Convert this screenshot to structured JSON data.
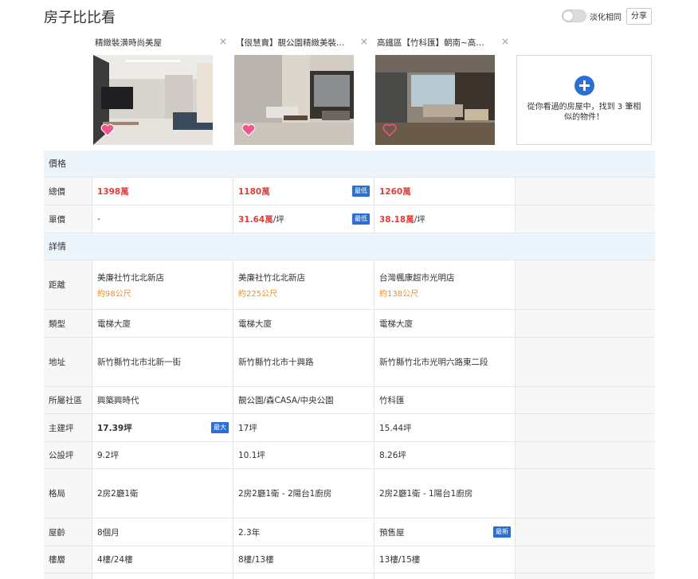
{
  "header": {
    "title": "房子比比看",
    "toggle_label": "淡化相同",
    "share_label": "分享"
  },
  "colors": {
    "accent": "#2c6fd4",
    "price": "#e03c3c",
    "distance": "#f08c1f",
    "section_bg": "#edf5fc",
    "heart": "#f0568c"
  },
  "cards": [
    {
      "title": "精緻裝潢時尚美屋",
      "close": "×",
      "heart": "filled"
    },
    {
      "title": "【很慧賣】靚公園精緻美裝…",
      "close": "×",
      "heart": "filled"
    },
    {
      "title": "高鐵區【竹科匯】朝南~高…",
      "close": "×",
      "heart": "outline"
    }
  ],
  "add_card": {
    "text": "從你看過的房屋中，找到 3 筆相似的物件！"
  },
  "sections": {
    "price": "價格",
    "details": "詳情"
  },
  "rows": {
    "total_price": {
      "label": "總價",
      "values": [
        "1398萬",
        "1180萬",
        "1260萬"
      ],
      "badge": "最低"
    },
    "unit_price": {
      "label": "單價",
      "values": [
        "-",
        "31.64萬",
        "38.18萬"
      ],
      "unit": "/坪",
      "badge": "最低"
    },
    "distance": {
      "label": "距離",
      "places": [
        "美廉社竹北北新店",
        "美廉社竹北北新店",
        "台灣楓康超市光明店"
      ],
      "distances": [
        "約98公尺",
        "約225公尺",
        "約138公尺"
      ]
    },
    "type": {
      "label": "類型",
      "values": [
        "電梯大廈",
        "電梯大廈",
        "電梯大廈"
      ]
    },
    "address": {
      "label": "地址",
      "values": [
        "新竹縣竹北市北新一街",
        "新竹縣竹北市十興路",
        "新竹縣竹北市光明六路東二段"
      ]
    },
    "community": {
      "label": "所屬社區",
      "values": [
        "興築興時代",
        "靚公園/森CASA/中央公園",
        "竹科匯"
      ]
    },
    "main_area": {
      "label": "主建坪",
      "values": [
        "17.39坪",
        "17坪",
        "15.44坪"
      ],
      "badge": "最大"
    },
    "public_area": {
      "label": "公設坪",
      "values": [
        "9.2坪",
        "10.1坪",
        "8.26坪"
      ]
    },
    "layout": {
      "label": "格局",
      "values": [
        "2房2廳1衛",
        "2房2廳1衛 - 2陽台1廚房",
        "2房2廳1衛 - 1陽台1廚房"
      ]
    },
    "age": {
      "label": "屋齡",
      "values": [
        "8個月",
        "2.3年",
        "預售屋"
      ],
      "badge": "最新"
    },
    "floor": {
      "label": "樓層",
      "values": [
        "4樓/24樓",
        "8樓/13樓",
        "13樓/15樓"
      ]
    }
  }
}
